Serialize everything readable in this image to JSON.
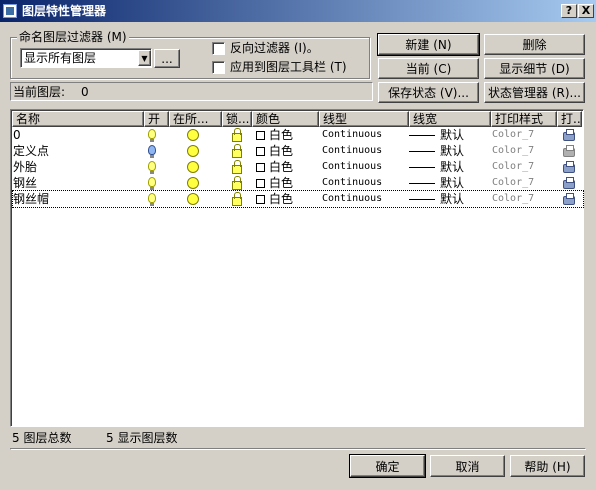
{
  "window": {
    "title": "图层特性管理器",
    "help_btn": "?",
    "close_btn": "X"
  },
  "filter": {
    "group_label": "命名图层过滤器 (M)",
    "selected": "显示所有图层",
    "more_btn": "...",
    "invert_label": "反向过滤器 (I)。",
    "apply_toolbar_label": "应用到图层工具栏 (T)"
  },
  "buttons": {
    "new": "新建 (N)",
    "delete": "删除",
    "current": "当前 (C)",
    "show_details": "显示细节 (D)",
    "save_state": "保存状态 (V)...",
    "state_manager": "状态管理器 (R)...",
    "ok": "确定",
    "cancel": "取消",
    "help": "帮助 (H)"
  },
  "current_layer": {
    "label": "当前图层:",
    "value": "0"
  },
  "table": {
    "columns": [
      "名称",
      "开",
      "在所...",
      "锁...",
      "颜色",
      "线型",
      "线宽",
      "打印样式",
      "打..."
    ],
    "rows": [
      {
        "name": "0",
        "on_icon": "bulb-on-icon",
        "color": "白色",
        "linetype": "Continuous",
        "lineweight": "默认",
        "plot_style": "Color_7",
        "plot_icon": "printer-icon"
      },
      {
        "name": "定义点",
        "on_icon": "bulb-blue-icon",
        "color": "白色",
        "linetype": "Continuous",
        "lineweight": "默认",
        "plot_style": "Color_7",
        "plot_icon": "printer-disabled-icon"
      },
      {
        "name": "外胎",
        "on_icon": "bulb-on-icon",
        "color": "白色",
        "linetype": "Continuous",
        "lineweight": "默认",
        "plot_style": "Color_7",
        "plot_icon": "printer-icon"
      },
      {
        "name": "钢丝",
        "on_icon": "bulb-on-icon",
        "color": "白色",
        "linetype": "Continuous",
        "lineweight": "默认",
        "plot_style": "Color_7",
        "plot_icon": "printer-icon"
      },
      {
        "name": "钢丝帽",
        "on_icon": "bulb-on-icon",
        "color": "白色",
        "linetype": "Continuous",
        "lineweight": "默认",
        "plot_style": "Color_7",
        "plot_icon": "printer-icon"
      }
    ]
  },
  "status": {
    "total": "5 图层总数",
    "shown": "5 显示图层数"
  },
  "colors": {
    "title_start": "#0a246a",
    "title_end": "#a6caf0",
    "face": "#d4d0c8"
  }
}
